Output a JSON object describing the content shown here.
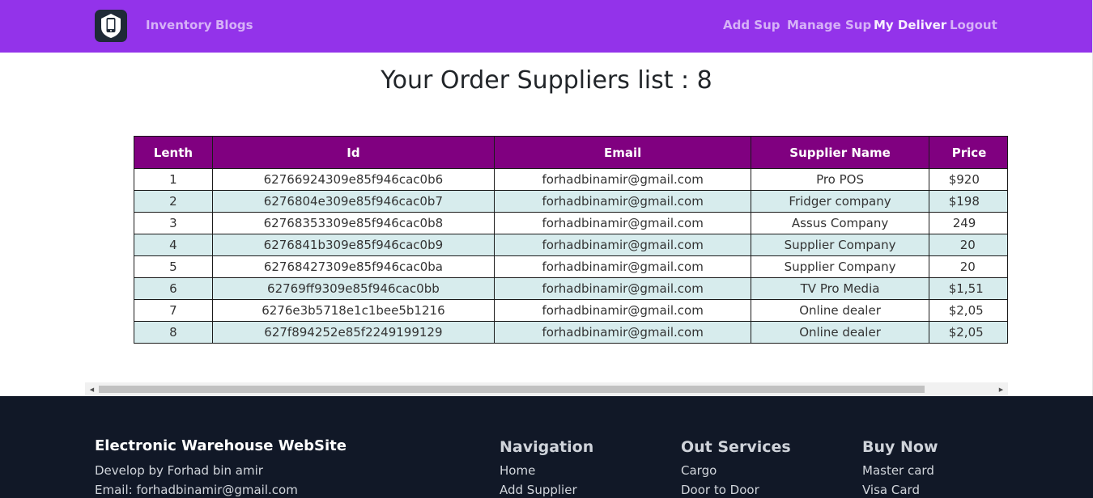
{
  "nav": {
    "left_links": [
      "Inventory",
      "Blogs"
    ],
    "right_links": [
      "Add Sup",
      "Manage Sup",
      "My Deliver",
      "Logout"
    ],
    "active": "My Deliver",
    "logo_icon": "phone-shield-icon",
    "bg_color": "#9333ea"
  },
  "page": {
    "title": "Your Order Suppliers list : 8"
  },
  "table": {
    "headers": [
      "Lenth",
      "Id",
      "Email",
      "Supplier Name",
      "Price"
    ],
    "rows": [
      [
        "1",
        "62766924309e85f946cac0b6",
        "forhadbinamir@gmail.com",
        "Pro POS",
        "$920"
      ],
      [
        "2",
        "6276804e309e85f946cac0b7",
        "forhadbinamir@gmail.com",
        "Fridger company",
        "$198"
      ],
      [
        "3",
        "62768353309e85f946cac0b8",
        "forhadbinamir@gmail.com",
        "Assus Company",
        "249"
      ],
      [
        "4",
        "6276841b309e85f946cac0b9",
        "forhadbinamir@gmail.com",
        "Supplier Company",
        "20"
      ],
      [
        "5",
        "62768427309e85f946cac0ba",
        "forhadbinamir@gmail.com",
        "Supplier Company",
        "20"
      ],
      [
        "6",
        "62769ff9309e85f946cac0bb",
        "forhadbinamir@gmail.com",
        "TV Pro Media",
        "$1,51"
      ],
      [
        "7",
        "6276e3b5718e1c1bee5b1216",
        "forhadbinamir@gmail.com",
        "Online dealer",
        "$2,05"
      ],
      [
        "8",
        "627f894252e85f2249199129",
        "forhadbinamir@gmail.com",
        "Online dealer",
        "$2,05"
      ]
    ],
    "header_color": "#800080",
    "stripe_color": "#d7eced"
  },
  "footer": {
    "brand": "Electronic Warehouse WebSite",
    "brand_lines": [
      "Develop by Forhad bin amir",
      "Email: forhadbinamir@gmail.com"
    ],
    "navigation": {
      "title": "Navigation",
      "links": [
        "Home",
        "Add Supplier"
      ]
    },
    "services": {
      "title": "Out Services",
      "links": [
        "Cargo",
        "Door to Door"
      ]
    },
    "buy": {
      "title": "Buy Now",
      "links": [
        "Master card",
        "Visa Card"
      ]
    },
    "bg_color": "#111827"
  }
}
